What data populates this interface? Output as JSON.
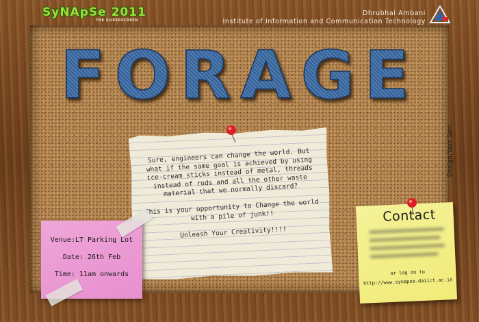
{
  "header": {
    "logo_text": "SyNApSe 2011",
    "logo_tagline": "THE SILVERSCREEN",
    "institute_line1": "Dhrubhai Ambani",
    "institute_line2": "Institute of Information and Communication Technology",
    "institute_logo_icon": "daiict-triangle-logo-icon"
  },
  "event": {
    "title": "FORAGE"
  },
  "description": {
    "paragraph1": "Sure, engineers can change the world. But what if the same goal is achieved by using ice-cream sticks instead of metal, threads instead of rods and all the other waste material that we normally discard?",
    "paragraph2": "This is your opportunity to Change the world with a pile of junk!!",
    "paragraph3": "Unleash Your Creativity!!!!"
  },
  "details": {
    "venue": "Venue:LT Parking Lot",
    "date": "Date: 26th Feb",
    "time": "Time: 11am onwards"
  },
  "contact": {
    "title": "Contact",
    "log_text": "or log on to",
    "url": "http://www.synapse.daiict.ac.in"
  },
  "credit": {
    "designer": "Design:Yash Soni"
  },
  "colors": {
    "frame": "#7a4a22",
    "cork": "#b88a55",
    "denim": "#3f6da2",
    "pink_note": "#eea6d8",
    "yellow_note": "#f3ee88",
    "pin": "#d8202a"
  }
}
